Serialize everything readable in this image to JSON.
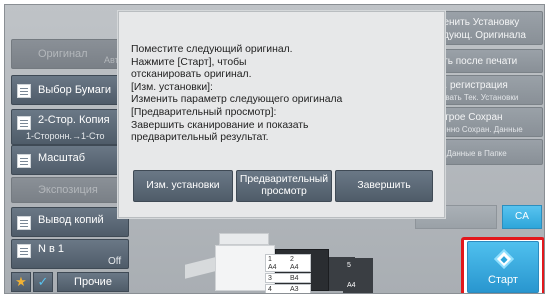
{
  "left_panel": {
    "original": "Оригинал",
    "original_sub": "Авто",
    "paper_select": "Выбор Бумаги",
    "duplex": "2-Стор. Копия",
    "duplex_sub": "1-Сторонн.→1-Сто",
    "zoom": "Масштаб",
    "exposure": "Экспозиция",
    "output": "Вывод копий",
    "n_up": "N в 1",
    "n_up_value": "Off",
    "other": "Прочие"
  },
  "right_panel": {
    "change_settings_l1": "зменить Установку",
    "change_settings_l2": "ледующ. Оригинала",
    "send_after_print": "дать после печати",
    "quick_reg_l1": "ам. регистрация",
    "quick_reg_l2": "ировать Тек. Установки",
    "quick_save_l1": "ыстрое Сохран",
    "quick_save_l2": "еменно Сохран. Данные",
    "file_save": "ить Данные в Папке",
    "ca": "CA",
    "start": "Старт"
  },
  "machine": {
    "trays": [
      {
        "num": "1",
        "size": "A4",
        "num2": "2",
        "size2": "A4"
      },
      {
        "num": "3",
        "size": "B4"
      },
      {
        "num": "4",
        "size": "A3"
      }
    ],
    "bypass": "5",
    "bypass_size": "A4"
  },
  "dialog": {
    "message": "Поместите следующий оригинал.\nНажмите [Старт], чтобы\nотсканировать оригинал.\n[Изм. установки]:\nИзменить параметр следующего оригинала\n[Предварительный просмотр]:\nЗавершить сканирование и показать\nпредварительный результат.",
    "btn_change": "Изм. установки",
    "btn_preview": "Предварительный просмотр",
    "btn_finish": "Завершить"
  },
  "colors": {
    "start_highlight": "#e2171c",
    "accent_blue": "#2ea6da",
    "button_dark": "#4f5c69"
  }
}
